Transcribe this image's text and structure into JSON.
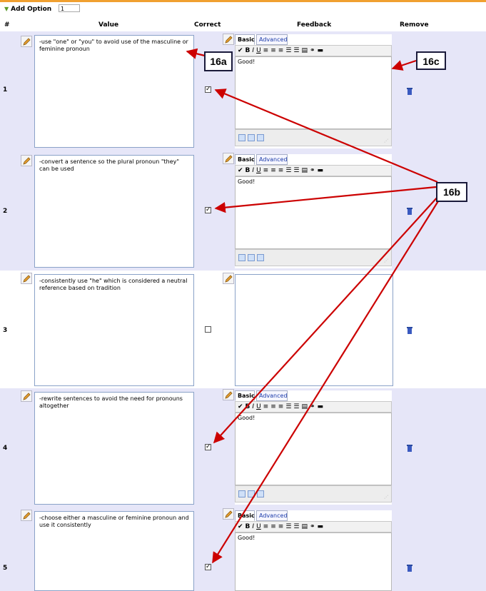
{
  "top": {
    "add_option_label": "Add Option",
    "add_option_value": "1"
  },
  "header": {
    "num": "#",
    "value": "Value",
    "correct": "Correct",
    "feedback": "Feedback",
    "remove": "Remove"
  },
  "editor": {
    "tab_basic": "Basic",
    "tab_advanced": "Advanced"
  },
  "rows": [
    {
      "num": "1",
      "value": "-use \"one\" or \"you\" to avoid use of the masculine or feminine pronoun",
      "correct": true,
      "feedback": "Good!"
    },
    {
      "num": "2",
      "value": "-convert a sentence so the plural pronoun \"they\" can be used",
      "correct": true,
      "feedback": "Good!"
    },
    {
      "num": "3",
      "value": "-consistently use \"he\" which is considered a neutral reference based on tradition",
      "correct": false,
      "feedback": ""
    },
    {
      "num": "4",
      "value": "-rewrite sentences to avoid the need for pronouns altogether",
      "correct": true,
      "feedback": "Good!"
    },
    {
      "num": "5",
      "value": "-choose either a masculine or feminine pronoun and use it consistently",
      "correct": true,
      "feedback": "Good!"
    }
  ],
  "callouts": {
    "a": "16a",
    "b": "16b",
    "c": "16c"
  },
  "colors": {
    "row_shade": "#e6e6f8",
    "arrow": "#cc0000",
    "accent_bar": "#f0a030"
  }
}
